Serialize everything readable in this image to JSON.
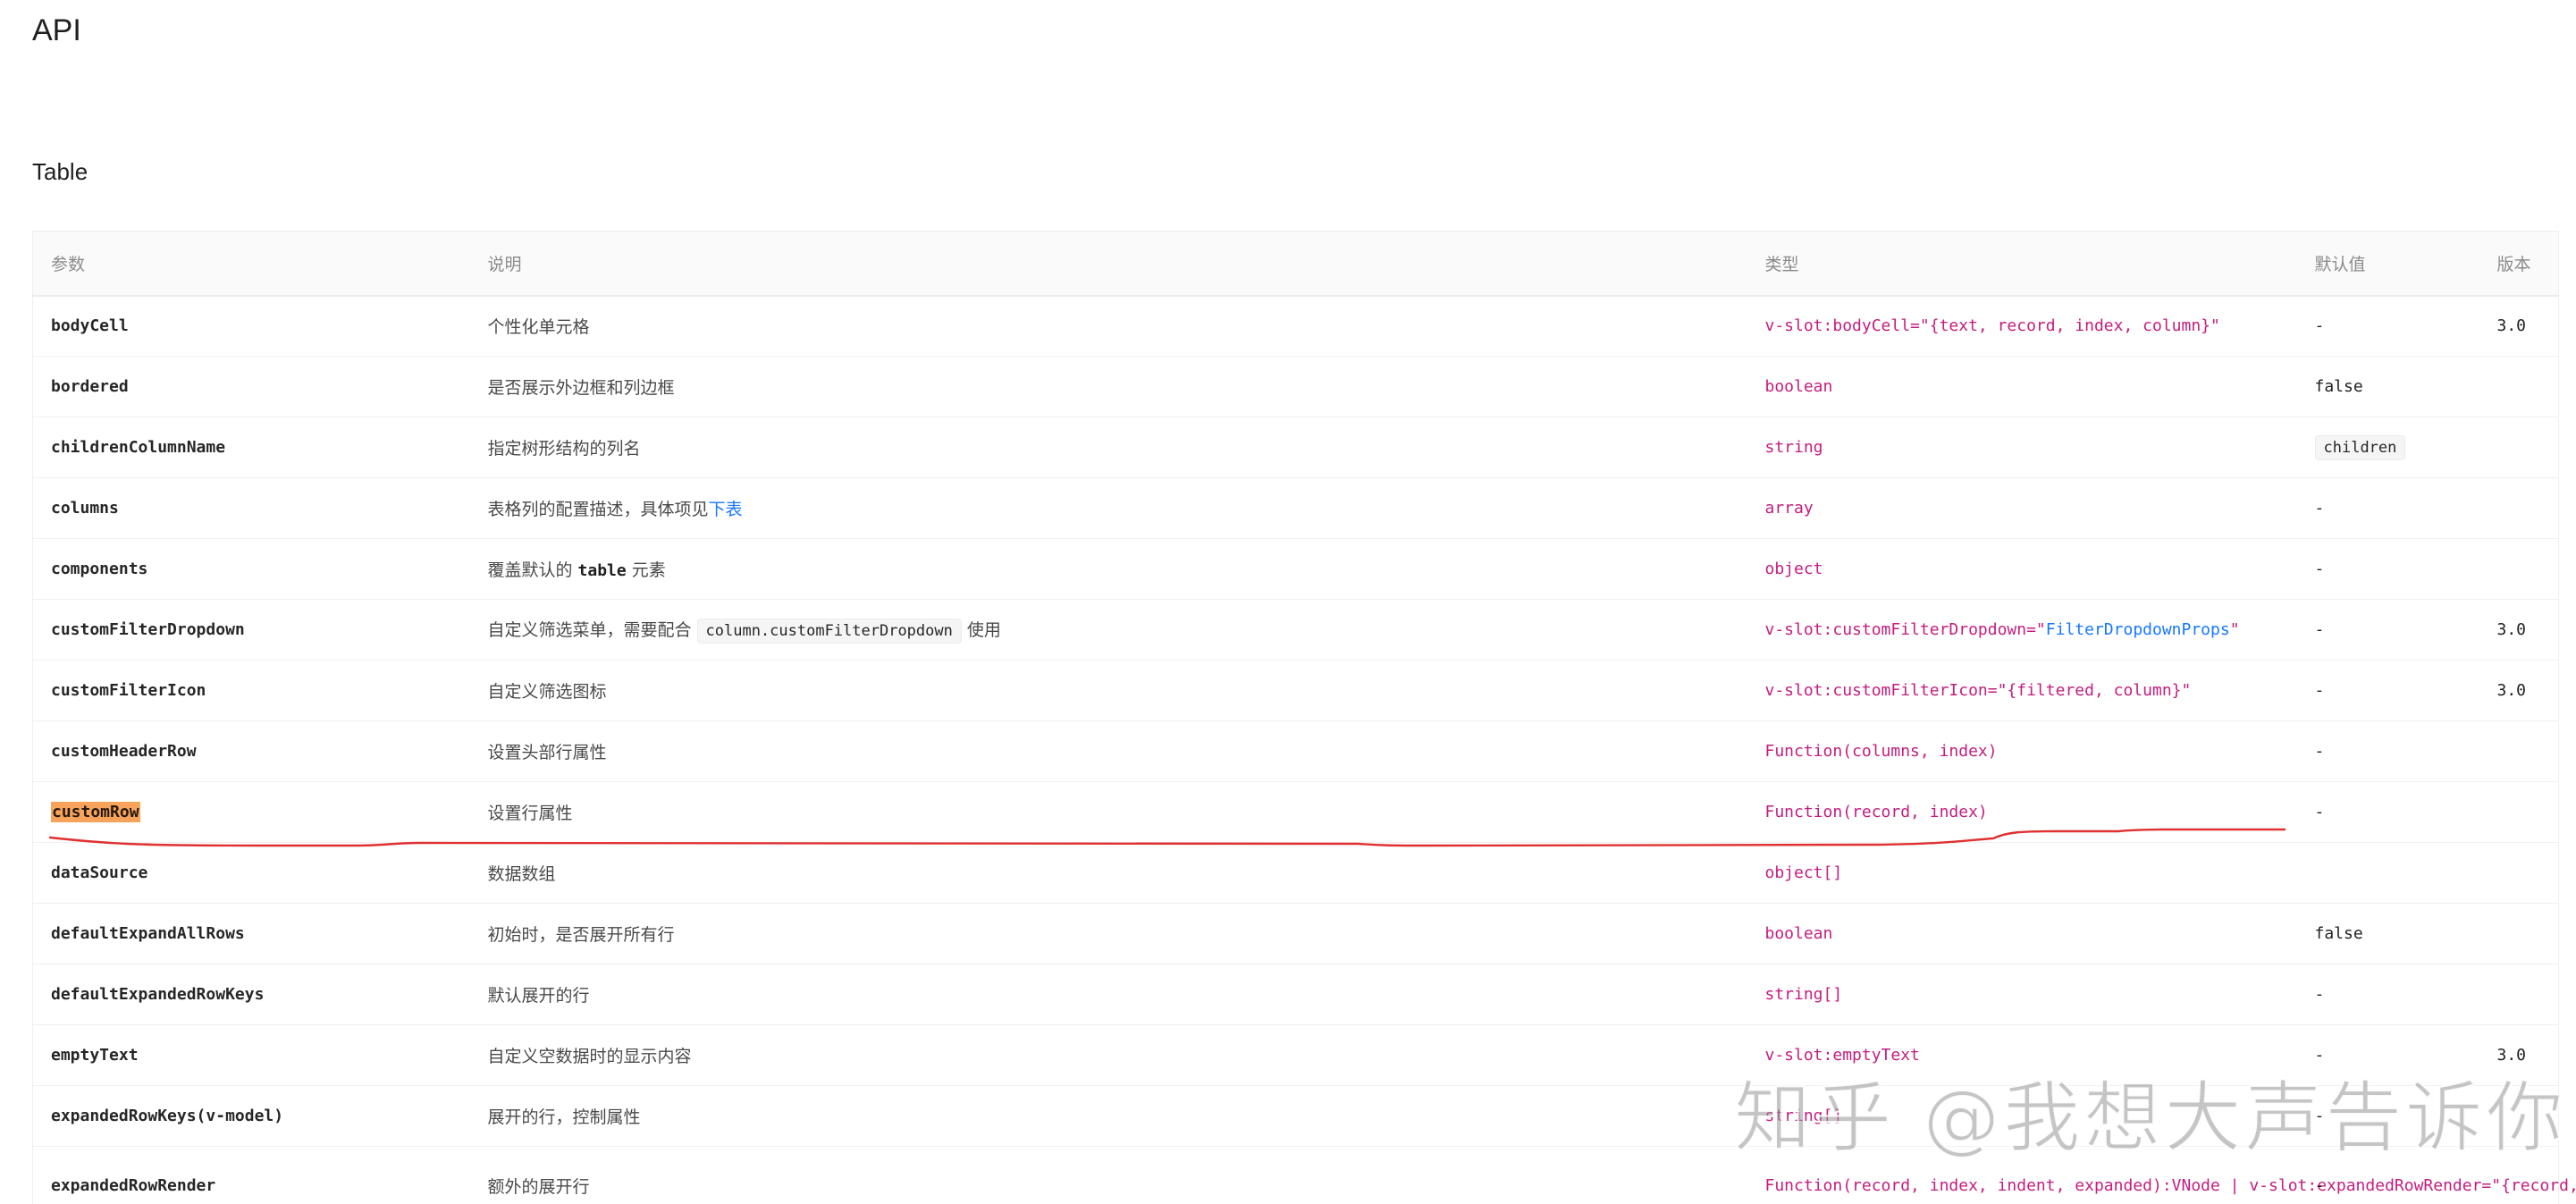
{
  "headings": {
    "api": "API",
    "table": "Table"
  },
  "table": {
    "headers": [
      "参数",
      "说明",
      "类型",
      "默认值",
      "版本"
    ],
    "rows": [
      {
        "param": "bodyCell",
        "desc": "个性化单元格",
        "type": "v-slot:bodyCell=\"{text, record, index, column}\"",
        "default": "-",
        "version": "3.0"
      },
      {
        "param": "bordered",
        "desc": "是否展示外边框和列边框",
        "type": "boolean",
        "default": "false",
        "version": ""
      },
      {
        "param": "childrenColumnName",
        "desc": "指定树形结构的列名",
        "type": "string",
        "default": "children",
        "version": ""
      },
      {
        "param": "columns",
        "desc_before": "表格列的配置描述，具体项见",
        "desc_link": "下表",
        "type": "array",
        "default": "-",
        "version": ""
      },
      {
        "param": "components",
        "desc_before": "覆盖默认的",
        "desc_code": "table",
        "desc_after": "元素",
        "type": "object",
        "default": "-",
        "version": ""
      },
      {
        "param": "customFilterDropdown",
        "desc_before": "自定义筛选菜单，需要配合",
        "desc_code": "column.customFilterDropdown",
        "desc_after": "使用",
        "type_before": "v-slot:customFilterDropdown=\"",
        "type_link": "FilterDropdownProps",
        "type_after": "\"",
        "default": "-",
        "version": "3.0"
      },
      {
        "param": "customFilterIcon",
        "desc": "自定义筛选图标",
        "type": "v-slot:customFilterIcon=\"{filtered, column}\"",
        "default": "-",
        "version": "3.0"
      },
      {
        "param": "customHeaderRow",
        "desc": "设置头部行属性",
        "type": "Function(columns, index)",
        "default": "-",
        "version": ""
      },
      {
        "param": "customRow",
        "desc": "设置行属性",
        "type": "Function(record, index)",
        "default": "-",
        "version": ""
      },
      {
        "param": "dataSource",
        "desc": "数据数组",
        "type": "object[]",
        "default": "",
        "version": ""
      },
      {
        "param": "defaultExpandAllRows",
        "desc": "初始时，是否展开所有行",
        "type": "boolean",
        "default": "false",
        "version": ""
      },
      {
        "param": "defaultExpandedRowKeys",
        "desc": "默认展开的行",
        "type": "string[]",
        "default": "-",
        "version": ""
      },
      {
        "param": "emptyText",
        "desc": "自定义空数据时的显示内容",
        "type": "v-slot:emptyText",
        "default": "-",
        "version": "3.0"
      },
      {
        "param": "expandedRowKeys(v-model)",
        "desc": "展开的行，控制属性",
        "type": "string[]",
        "default": "-",
        "version": ""
      },
      {
        "param": "expandedRowRender",
        "desc": "额外的展开行",
        "type": "Function(record, index, indent, expanded):VNode | v-slot:expandedRowRender=\"{record, index, indent, expanded}\"",
        "default": "-",
        "version": ""
      }
    ]
  },
  "watermark": "知乎 @我想大声告诉你",
  "colors": {
    "type_text": "#c41d7f",
    "link": "#1677ff",
    "highlight": "#f7a35c",
    "annotation_line": "#e03030"
  }
}
